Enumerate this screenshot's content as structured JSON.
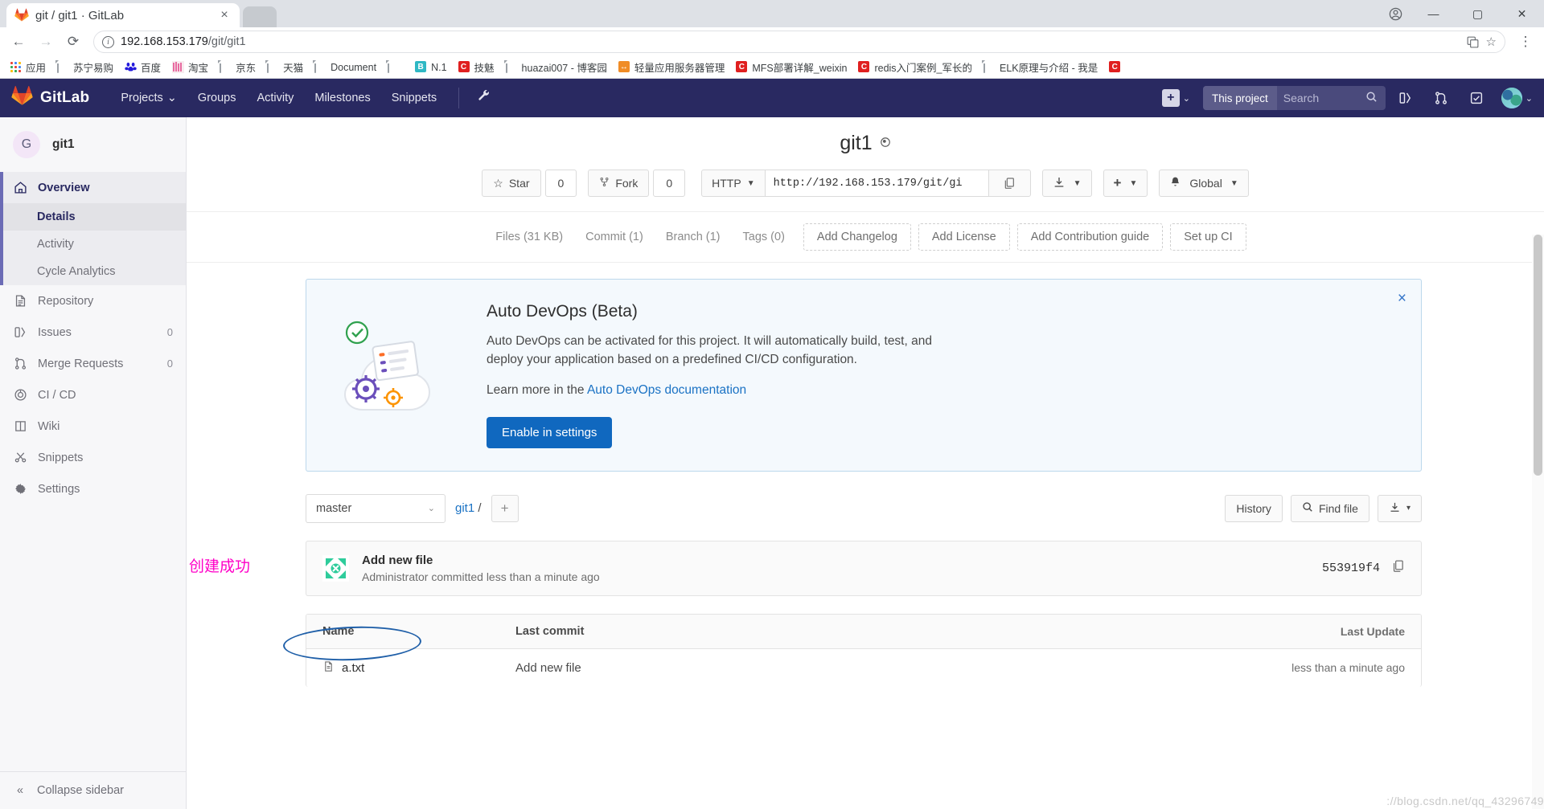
{
  "browser": {
    "tab": {
      "title": "git / git1 · GitLab",
      "favicon": "gitlab-icon",
      "close": "×"
    },
    "window_controls": {
      "minimize": "—",
      "maximize": "▢",
      "close": "✕",
      "profile": "account-icon"
    },
    "toolbar": {
      "back": "←",
      "forward": "→",
      "reload": "⟳",
      "url_main": "192.168.153.179",
      "url_path": "/git/git1",
      "info_icon": "ⓘ",
      "translate_icon": "translate-icon",
      "star_icon": "☆",
      "menu_icon": "⋮"
    },
    "bookmarks": [
      {
        "label": "应用",
        "icon": "apps-grid"
      },
      {
        "label": "苏宁易购",
        "icon": "doc"
      },
      {
        "label": "百度",
        "icon": "baidu"
      },
      {
        "label": "淘宝",
        "icon": "taobao"
      },
      {
        "label": "京东",
        "icon": "doc"
      },
      {
        "label": "天猫",
        "icon": "doc"
      },
      {
        "label": "Document",
        "icon": "doc"
      },
      {
        "label": "",
        "icon": "doc"
      },
      {
        "label": "N.1",
        "icon": "blue-b"
      },
      {
        "label": "技魅",
        "icon": "red-c"
      },
      {
        "label": "huazai007 - 博客园",
        "icon": "doc"
      },
      {
        "label": "轻量应用服务器管理",
        "icon": "orange-link"
      },
      {
        "label": "MFS部署详解_weixin",
        "icon": "red-c"
      },
      {
        "label": "redis入门案例_军长的",
        "icon": "red-c"
      },
      {
        "label": "ELK原理与介绍 - 我是",
        "icon": "doc"
      },
      {
        "label": "",
        "icon": "red-c"
      }
    ]
  },
  "navbar": {
    "brand": "GitLab",
    "links": [
      {
        "label": "Projects",
        "has_caret": true
      },
      {
        "label": "Groups",
        "has_caret": false
      },
      {
        "label": "Activity",
        "has_caret": false
      },
      {
        "label": "Milestones",
        "has_caret": false
      },
      {
        "label": "Snippets",
        "has_caret": false
      }
    ],
    "wrench_icon": "wrench-icon",
    "plus_icon": "+",
    "search_scope": "This project",
    "search_placeholder": "Search",
    "search_value": "",
    "icons": {
      "issues": "issues-icon",
      "merge": "merge-requests-icon",
      "todos": "todos-icon"
    }
  },
  "sidebar": {
    "project_initial": "G",
    "project_name": "git1",
    "overview": {
      "label": "Overview",
      "icon": "home-icon"
    },
    "sub_items": [
      {
        "label": "Details",
        "current": true
      },
      {
        "label": "Activity",
        "current": false
      },
      {
        "label": "Cycle Analytics",
        "current": false
      }
    ],
    "items": [
      {
        "label": "Repository",
        "icon": "repository-icon",
        "badge": ""
      },
      {
        "label": "Issues",
        "icon": "issues-icon",
        "badge": "0"
      },
      {
        "label": "Merge Requests",
        "icon": "merge-requests-icon",
        "badge": "0"
      },
      {
        "label": "CI / CD",
        "icon": "cicd-icon",
        "badge": ""
      },
      {
        "label": "Wiki",
        "icon": "wiki-icon",
        "badge": ""
      },
      {
        "label": "Snippets",
        "icon": "snippets-icon",
        "badge": ""
      },
      {
        "label": "Settings",
        "icon": "gear-icon",
        "badge": ""
      }
    ],
    "collapse": {
      "label": "Collapse sidebar",
      "icon": "chevron-left-icon"
    }
  },
  "project": {
    "title": "git1",
    "visibility_icon": "private-icon",
    "star_label": "Star",
    "star_count": "0",
    "fork_label": "Fork",
    "fork_count": "0",
    "clone_protocol": "HTTP",
    "clone_url": "http://192.168.153.179/git/gi",
    "copy_icon": "copy-icon",
    "download_icon": "download-icon",
    "add_icon": "+",
    "notify_label": "Global",
    "notify_icon": "bell-icon"
  },
  "stats": {
    "items": [
      {
        "label": "Files (31 KB)"
      },
      {
        "label": "Commit (1)"
      },
      {
        "label": "Branch (1)"
      },
      {
        "label": "Tags (0)"
      }
    ],
    "buttons": [
      "Add Changelog",
      "Add License",
      "Add Contribution guide",
      "Set up CI"
    ]
  },
  "devops": {
    "title": "Auto DevOps (Beta)",
    "paragraph": "Auto DevOps can be activated for this project. It will automatically build, test, and deploy your application based on a predefined CI/CD configuration.",
    "learn_prefix": "Learn more in the ",
    "learn_link": "Auto DevOps documentation",
    "cta": "Enable in settings",
    "close": "×"
  },
  "repo": {
    "branch": "master",
    "breadcrumb_project": "git1",
    "breadcrumb_sep": "/",
    "add_icon": "+",
    "history_label": "History",
    "find_file_label": "Find file",
    "find_icon": "search-icon",
    "download_icon": "download-icon",
    "caret": "▾"
  },
  "commit": {
    "message": "Add new file",
    "meta": "Administrator committed less than a minute ago",
    "sha": "553919f4",
    "copy_icon": "copy-icon"
  },
  "files": {
    "columns": [
      "Name",
      "Last commit",
      "Last Update"
    ],
    "rows": [
      {
        "name": "a.txt",
        "icon": "file-icon",
        "last_commit": "Add new file",
        "last_update": "less than a minute ago"
      }
    ]
  },
  "annotations": {
    "success_note": "创建成功",
    "note_color": "#ff00c8",
    "ellipse_color": "#1f5fa8",
    "watermark": "://blog.csdn.net/qq_43296749"
  }
}
